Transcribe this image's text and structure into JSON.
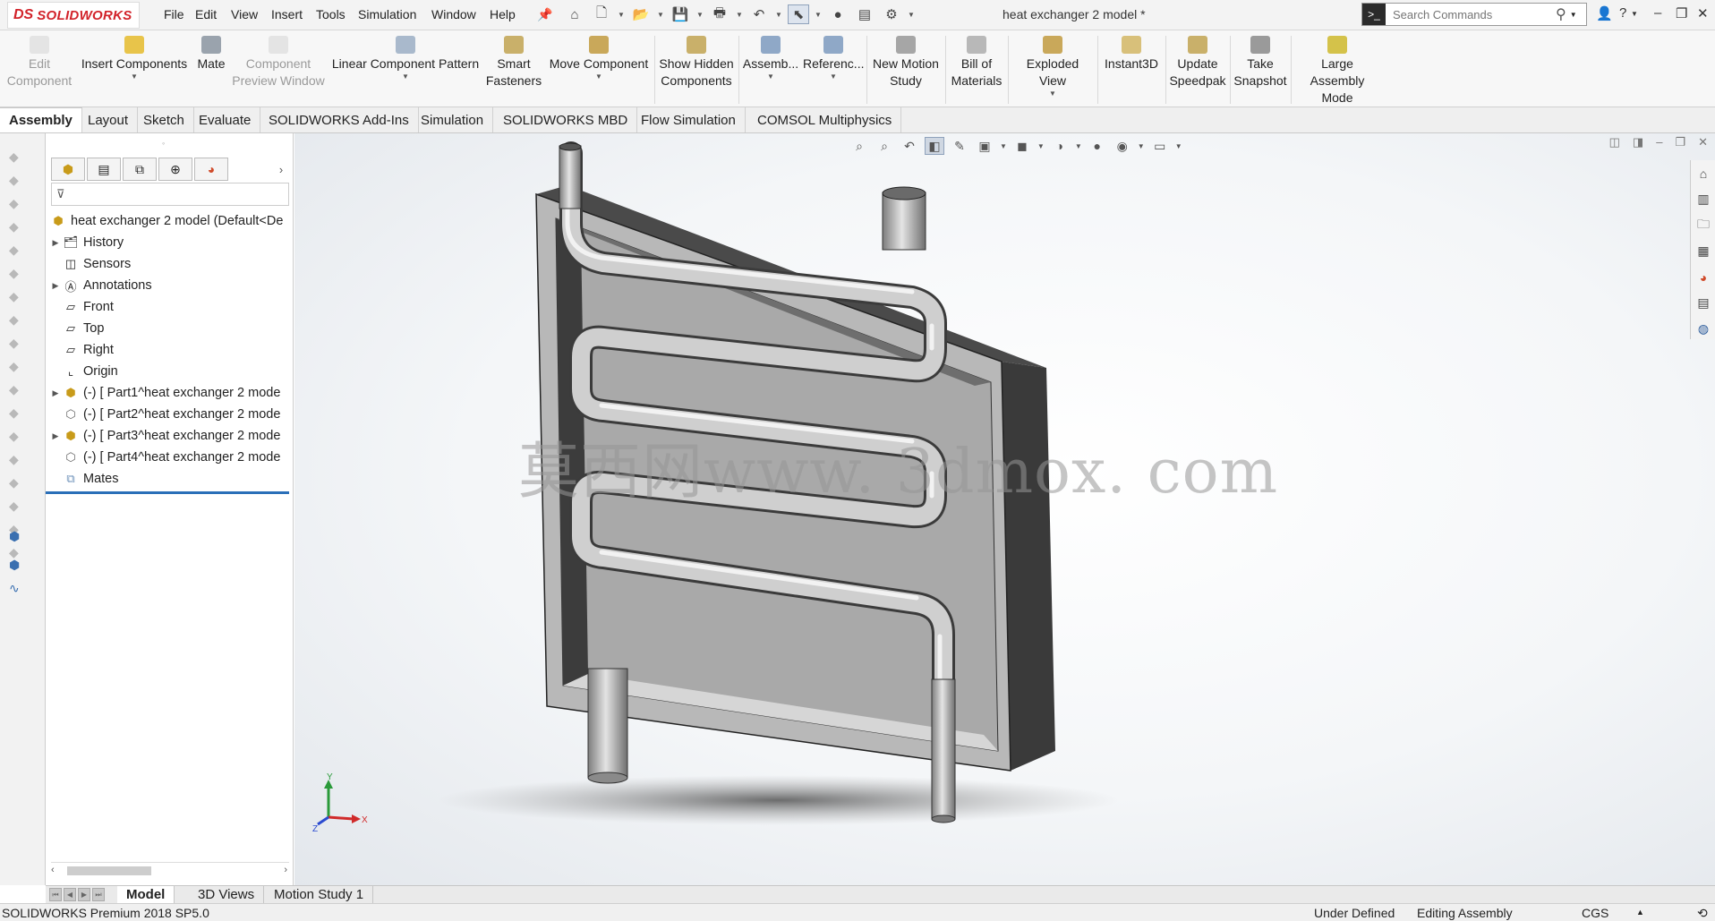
{
  "app": {
    "logo_ds": "DS",
    "logo_name": "SOLIDWORKS"
  },
  "menu": [
    "File",
    "Edit",
    "View",
    "Insert",
    "Tools",
    "Simulation",
    "Window",
    "Help"
  ],
  "document_title": "heat exchanger 2 model *",
  "search": {
    "placeholder": "Search Commands"
  },
  "ribbon": [
    {
      "label": "Edit Component",
      "enabled": false
    },
    {
      "label": "Insert Components",
      "enabled": true
    },
    {
      "label": "Mate",
      "enabled": true
    },
    {
      "label": "Component Preview Window",
      "enabled": false
    },
    {
      "label": "Linear Component Pattern",
      "enabled": true
    },
    {
      "label": "Smart Fasteners",
      "enabled": true
    },
    {
      "label": "Move Component",
      "enabled": true
    },
    {
      "label": "Show Hidden Components",
      "enabled": true
    },
    {
      "label": "Assemb...",
      "enabled": true
    },
    {
      "label": "Referenc...",
      "enabled": true
    },
    {
      "label": "New Motion Study",
      "enabled": true
    },
    {
      "label": "Bill of Materials",
      "enabled": true
    },
    {
      "label": "Exploded View",
      "enabled": true
    },
    {
      "label": "Instant3D",
      "enabled": true
    },
    {
      "label": "Update Speedpak",
      "enabled": true
    },
    {
      "label": "Take Snapshot",
      "enabled": true
    },
    {
      "label": "Large Assembly Mode",
      "enabled": true
    }
  ],
  "tabs": [
    "Assembly",
    "Layout",
    "Sketch",
    "Evaluate",
    "SOLIDWORKS Add-Ins",
    "Simulation",
    "SOLIDWORKS MBD",
    "Flow Simulation",
    "COMSOL Multiphysics"
  ],
  "feature_tree": {
    "root": "heat exchanger 2 model  (Default<De",
    "items": [
      {
        "label": "History",
        "expandable": true
      },
      {
        "label": "Sensors",
        "expandable": false
      },
      {
        "label": "Annotations",
        "expandable": true
      },
      {
        "label": "Front",
        "expandable": false
      },
      {
        "label": "Top",
        "expandable": false
      },
      {
        "label": "Right",
        "expandable": false
      },
      {
        "label": "Origin",
        "expandable": false
      },
      {
        "label": "(-) [ Part1^heat exchanger 2 mode",
        "expandable": true
      },
      {
        "label": "(-) [ Part2^heat exchanger 2 mode",
        "expandable": false
      },
      {
        "label": "(-) [ Part3^heat exchanger 2 mode",
        "expandable": true
      },
      {
        "label": "(-) [ Part4^heat exchanger 2 mode",
        "expandable": false
      },
      {
        "label": "Mates",
        "expandable": false
      }
    ]
  },
  "watermark": "莫西网www. 3dmox. com",
  "triad": {
    "x": "X",
    "y": "Y",
    "z": "Z"
  },
  "bottom_tabs": [
    "Model",
    "3D Views",
    "Motion Study 1"
  ],
  "status": {
    "product": "SOLIDWORKS Premium 2018 SP5.0",
    "state": "Under Defined",
    "mode": "Editing Assembly",
    "units": "CGS"
  }
}
